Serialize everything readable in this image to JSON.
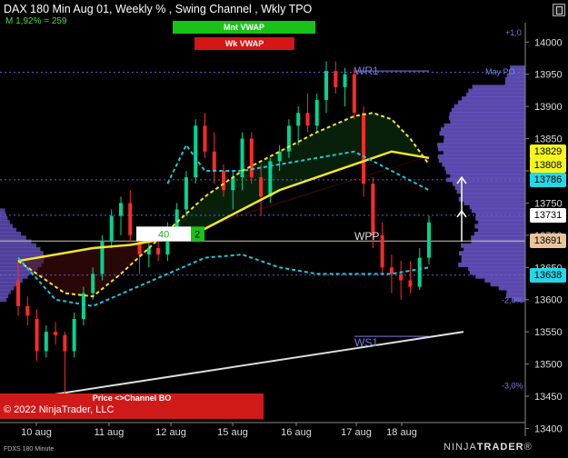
{
  "header": {
    "title": "DAX 180 Min Aug 01, Weekly % , Swing Channel , Wkly TPO",
    "subtitle": "M 1,92% = 259"
  },
  "buttons": {
    "mnt_vwap": "Mnt VWAP",
    "wk_vwap": "Wk VWAP"
  },
  "annotations": {
    "wr1": "WR1",
    "wpp": "WPP",
    "ws1": "WS1",
    "may_label": "May PO",
    "pct_up": "+1,0",
    "pct_dn": "-2,0%",
    "pct_dn2": "-3,0%",
    "box_value": "40",
    "box_num": "2"
  },
  "price_tags": [
    {
      "label": "13829",
      "value": 13829,
      "bg": "#f5f51e",
      "fg": "#000"
    },
    {
      "label": "13808",
      "value": 13808,
      "bg": "#f5f51e",
      "fg": "#000"
    },
    {
      "label": "13786",
      "value": 13786,
      "bg": "#25d7e6",
      "fg": "#000"
    },
    {
      "label": "13731",
      "value": 13731,
      "bg": "#ffffff",
      "fg": "#000"
    },
    {
      "label": "13691",
      "value": 13691,
      "bg": "#e8c39e",
      "fg": "#000"
    },
    {
      "label": "13638",
      "value": 13638,
      "bg": "#25d7e6",
      "fg": "#000"
    }
  ],
  "bottom_panel": {
    "label": "Price <>Channel BO",
    "copyright": "© 2022 NinjaTrader, LLC"
  },
  "footer": {
    "instrument": "FDXS 180 Minute",
    "logo_a": "NINJA",
    "logo_b": "TRADER",
    "logo_reg": "®"
  },
  "colors": {
    "background": "#000000",
    "up": "#00d68f",
    "down": "#ff2a2a",
    "vwap_yellow": "#f5e62a",
    "cyan": "#25c5d6",
    "profile": "#6a55c8",
    "pivot": "#5a64d8",
    "trend": "#dddddd"
  },
  "chart_data": {
    "type": "candlestick",
    "ylim": [
      13395,
      14030
    ],
    "y_ticks": [
      13400,
      13450,
      13500,
      13550,
      13600,
      13650,
      13700,
      13750,
      13800,
      13850,
      13900,
      13950,
      14000
    ],
    "x_labels": [
      "10 aug",
      "11 aug",
      "12 aug",
      "15 aug",
      "16 aug",
      "17 aug",
      "18 aug"
    ],
    "candles": [
      [
        13630,
        13660,
        13575,
        13590
      ],
      [
        13590,
        13605,
        13560,
        13575
      ],
      [
        13570,
        13585,
        13505,
        13520
      ],
      [
        13520,
        13560,
        13510,
        13550
      ],
      [
        13550,
        13565,
        13530,
        13545
      ],
      [
        13545,
        13550,
        13450,
        13520
      ],
      [
        13520,
        13580,
        13510,
        13570
      ],
      [
        13570,
        13620,
        13560,
        13610
      ],
      [
        13610,
        13650,
        13600,
        13640
      ],
      [
        13640,
        13700,
        13630,
        13690
      ],
      [
        13690,
        13740,
        13680,
        13730
      ],
      [
        13730,
        13760,
        13700,
        13750
      ],
      [
        13750,
        13770,
        13690,
        13700
      ],
      [
        13700,
        13710,
        13640,
        13670
      ],
      [
        13670,
        13690,
        13650,
        13680
      ],
      [
        13680,
        13700,
        13660,
        13670
      ],
      [
        13670,
        13720,
        13660,
        13705
      ],
      [
        13705,
        13750,
        13690,
        13740
      ],
      [
        13740,
        13800,
        13730,
        13790
      ],
      [
        13790,
        13880,
        13780,
        13870
      ],
      [
        13870,
        13890,
        13820,
        13830
      ],
      [
        13830,
        13860,
        13780,
        13800
      ],
      [
        13800,
        13810,
        13760,
        13770
      ],
      [
        13770,
        13800,
        13740,
        13790
      ],
      [
        13790,
        13860,
        13770,
        13850
      ],
      [
        13850,
        13860,
        13780,
        13790
      ],
      [
        13790,
        13810,
        13730,
        13760
      ],
      [
        13760,
        13820,
        13750,
        13815
      ],
      [
        13815,
        13840,
        13800,
        13830
      ],
      [
        13830,
        13880,
        13820,
        13870
      ],
      [
        13870,
        13900,
        13840,
        13890
      ],
      [
        13890,
        13920,
        13860,
        13870
      ],
      [
        13870,
        13920,
        13860,
        13910
      ],
      [
        13910,
        13970,
        13890,
        13955
      ],
      [
        13955,
        13970,
        13920,
        13930
      ],
      [
        13930,
        13960,
        13900,
        13950
      ],
      [
        13950,
        13960,
        13880,
        13890
      ],
      [
        13890,
        13900,
        13760,
        13780
      ],
      [
        13780,
        13790,
        13680,
        13700
      ],
      [
        13700,
        13720,
        13640,
        13650
      ],
      [
        13650,
        13670,
        13610,
        13640
      ],
      [
        13640,
        13660,
        13600,
        13630
      ],
      [
        13630,
        13660,
        13610,
        13620
      ],
      [
        13620,
        13680,
        13615,
        13665
      ],
      [
        13665,
        13730,
        13655,
        13720
      ]
    ],
    "lines": [
      {
        "color": "#f5e62a",
        "width": 2.5,
        "dash": "",
        "points": [
          [
            0,
            13660
          ],
          [
            4,
            13670
          ],
          [
            8,
            13680
          ],
          [
            12,
            13685
          ],
          [
            16,
            13695
          ],
          [
            20,
            13710
          ],
          [
            24,
            13740
          ],
          [
            28,
            13770
          ],
          [
            32,
            13790
          ],
          [
            36,
            13810
          ],
          [
            40,
            13830
          ],
          [
            44,
            13820
          ]
        ]
      },
      {
        "color": "#f5e62a",
        "width": 2,
        "dash": "4,3",
        "points": [
          [
            0,
            13660
          ],
          [
            2,
            13640
          ],
          [
            5,
            13610
          ],
          [
            8,
            13605
          ],
          [
            11,
            13640
          ],
          [
            14,
            13680
          ],
          [
            17,
            13720
          ],
          [
            20,
            13760
          ],
          [
            24,
            13800
          ],
          [
            28,
            13830
          ],
          [
            32,
            13860
          ],
          [
            36,
            13885
          ],
          [
            38,
            13890
          ],
          [
            40,
            13880
          ],
          [
            42,
            13850
          ],
          [
            44,
            13810
          ]
        ]
      },
      {
        "color": "#25c5d6",
        "width": 2,
        "dash": "4,3",
        "points": [
          [
            0,
            13665
          ],
          [
            4,
            13600
          ],
          [
            8,
            13590
          ],
          [
            12,
            13615
          ],
          [
            16,
            13640
          ],
          [
            20,
            13665
          ],
          [
            24,
            13670
          ],
          [
            28,
            13650
          ],
          [
            32,
            13640
          ],
          [
            36,
            13640
          ],
          [
            40,
            13640
          ],
          [
            44,
            13650
          ]
        ]
      },
      {
        "color": "#25c5d6",
        "width": 2,
        "dash": "4,3",
        "points": [
          [
            16,
            13780
          ],
          [
            18,
            13840
          ],
          [
            20,
            13800
          ],
          [
            24,
            13800
          ],
          [
            28,
            13810
          ],
          [
            32,
            13820
          ],
          [
            36,
            13830
          ],
          [
            40,
            13800
          ],
          [
            44,
            13770
          ]
        ]
      }
    ],
    "trendline": [
      [
        0,
        13440
      ],
      [
        44,
        13550
      ]
    ],
    "pivots": [
      {
        "name": "WR1",
        "value": 13955
      },
      {
        "name": "WPP",
        "value": 13691
      },
      {
        "name": "WS1",
        "value": 13543
      }
    ]
  }
}
